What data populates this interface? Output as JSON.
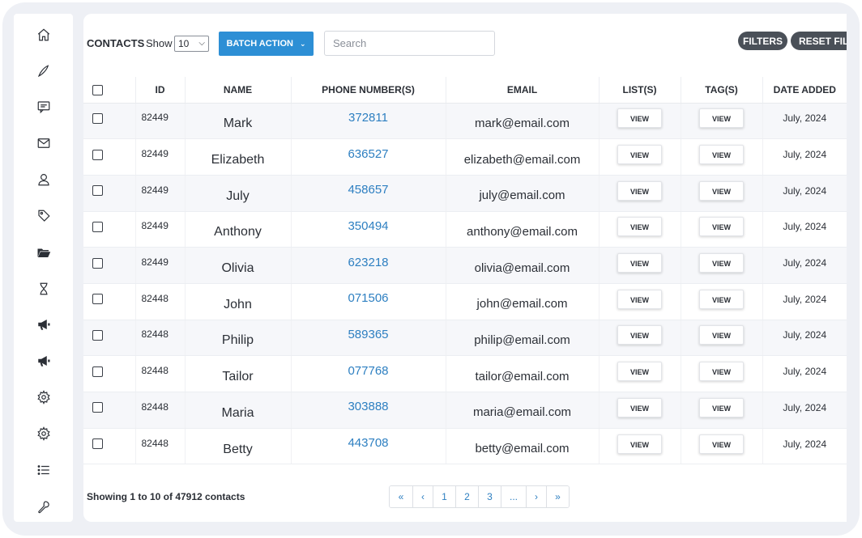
{
  "sidebar": {
    "items": [
      {
        "icon": "home-icon"
      },
      {
        "icon": "pen-icon"
      },
      {
        "icon": "message-icon"
      },
      {
        "icon": "mail-icon"
      },
      {
        "icon": "user-icon"
      },
      {
        "icon": "tag-icon"
      },
      {
        "icon": "folder-icon"
      },
      {
        "icon": "hourglass-icon"
      },
      {
        "icon": "megaphone-icon"
      },
      {
        "icon": "megaphone-icon"
      },
      {
        "icon": "gear-icon"
      },
      {
        "icon": "gear-icon"
      },
      {
        "icon": "list-icon"
      },
      {
        "icon": "wrench-icon"
      }
    ]
  },
  "toolbar": {
    "title": "CONTACTS",
    "show_label": "Show",
    "page_size": "10",
    "batch_label": "BATCH ACTION",
    "search_placeholder": "Search",
    "filters_label": "FILTERS",
    "reset_label": "RESET FILTERS",
    "accent_color": "#2d8fd5"
  },
  "table": {
    "columns": [
      "ID",
      "NAME",
      "PHONE NUMBER(S)",
      "EMAIL",
      "LIST(S)",
      "TAG(S)",
      "DATE ADDED"
    ],
    "view_label": "VIEW",
    "rows": [
      {
        "id": "82449",
        "name": "Mark",
        "phone": "372811",
        "email": "mark@email.com",
        "date": "July, 2024"
      },
      {
        "id": "82449",
        "name": "Elizabeth",
        "phone": "636527",
        "email": "elizabeth@email.com",
        "date": "July, 2024"
      },
      {
        "id": "82449",
        "name": "July",
        "phone": "458657",
        "email": "july@email.com",
        "date": "July, 2024"
      },
      {
        "id": "82449",
        "name": "Anthony",
        "phone": "350494",
        "email": "anthony@email.com",
        "date": "July, 2024"
      },
      {
        "id": "82449",
        "name": "Olivia",
        "phone": "623218",
        "email": "olivia@email.com",
        "date": "July, 2024"
      },
      {
        "id": "82448",
        "name": "John",
        "phone": "071506",
        "email": "john@email.com",
        "date": "July, 2024"
      },
      {
        "id": "82448",
        "name": "Philip",
        "phone": "589365",
        "email": "philip@email.com",
        "date": "July, 2024"
      },
      {
        "id": "82448",
        "name": "Tailor",
        "phone": "077768",
        "email": "tailor@email.com",
        "date": "July, 2024"
      },
      {
        "id": "82448",
        "name": "Maria",
        "phone": "303888",
        "email": "maria@email.com",
        "date": "July, 2024"
      },
      {
        "id": "82448",
        "name": "Betty",
        "phone": "443708",
        "email": "betty@email.com",
        "date": "July, 2024"
      }
    ]
  },
  "footer": {
    "showing_text": "Showing 1 to 10 of 47912 contacts",
    "pagination": [
      "«",
      "‹",
      "1",
      "2",
      "3",
      "...",
      "›",
      "»"
    ]
  }
}
